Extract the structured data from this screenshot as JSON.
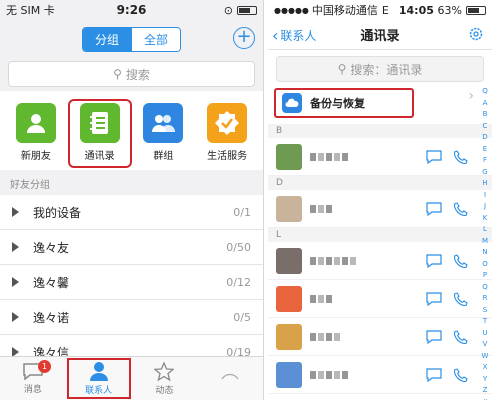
{
  "left": {
    "status": {
      "carrier": "无 SIM 卡",
      "time": "9:26"
    },
    "segment": {
      "active": "分组",
      "inactive": "全部"
    },
    "search_placeholder": "搜索",
    "grid": [
      {
        "label": "新朋友",
        "color": "#5fb82e",
        "icon": "person-icon"
      },
      {
        "label": "通讯录",
        "color": "#5fb82e",
        "icon": "address-book-icon",
        "highlighted": true
      },
      {
        "label": "群组",
        "color": "#2f86e0",
        "icon": "group-icon"
      },
      {
        "label": "生活服务",
        "color": "#f5a21b",
        "icon": "badge-check-icon"
      }
    ],
    "section_label": "好友分组",
    "groups": [
      {
        "name": "我的设备",
        "count": "0/1"
      },
      {
        "name": "逸々友",
        "count": "0/50"
      },
      {
        "name": "逸々馨",
        "count": "0/12"
      },
      {
        "name": "逸々诺",
        "count": "0/5"
      },
      {
        "name": "逸々信",
        "count": "0/19"
      }
    ],
    "tabs": [
      {
        "label": "消息",
        "badge": "1"
      },
      {
        "label": "联系人",
        "active": true
      },
      {
        "label": "动态"
      }
    ]
  },
  "right": {
    "status": {
      "carrier": "中国移动通信",
      "network": "E",
      "time": "14:05",
      "battery": "63%"
    },
    "back_label": "联系人",
    "title": "通讯录",
    "search_placeholder": "搜索：通讯录",
    "backup_label": "备份与恢复",
    "sections": [
      {
        "letter": "B",
        "contacts": [
          {
            "avatar": "#6f9a52"
          }
        ]
      },
      {
        "letter": "D",
        "contacts": [
          {
            "avatar": "#c9b39a"
          }
        ]
      },
      {
        "letter": "L",
        "contacts": [
          {
            "avatar": "#7a6e6a"
          },
          {
            "avatar": "#e7643d"
          },
          {
            "avatar": "#d9a24a"
          },
          {
            "avatar": "#5b8fd6"
          }
        ]
      }
    ],
    "index": [
      "Q",
      "A",
      "B",
      "C",
      "D",
      "E",
      "F",
      "G",
      "H",
      "I",
      "J",
      "K",
      "L",
      "M",
      "N",
      "O",
      "P",
      "Q",
      "R",
      "S",
      "T",
      "U",
      "V",
      "W",
      "X",
      "Y",
      "Z",
      "#"
    ]
  },
  "colors": {
    "accent": "#2b8fe6",
    "highlight": "#d0262d"
  }
}
